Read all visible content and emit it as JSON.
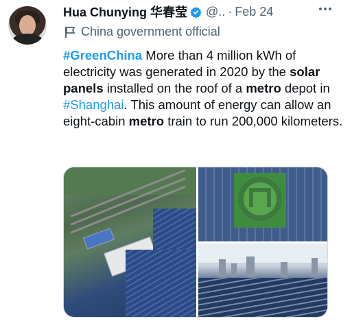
{
  "tweet": {
    "author_name": "Hua Chunying 华春莹",
    "handle": "@..",
    "separator": "·",
    "date": "Feb 24",
    "account_label": "China government official",
    "text": {
      "hashtag_green": "#GreenChina",
      "part1": " More than 4 million kWh of electricity was generated in 2020 by the ",
      "bold_solar": "solar panels",
      "part2": " installed on the roof of a ",
      "bold_metro1": "metro",
      "part3": " depot in ",
      "hashtag_shanghai": "#Shanghai",
      "part4": ". This amount of energy can allow an eight-cabin ",
      "bold_metro2": "metro",
      "part5": " train to run 200,000 kilometers."
    }
  },
  "icons": {
    "verified": "verified-badge-icon",
    "more": "more-options-icon",
    "government_label": "flag-icon"
  },
  "colors": {
    "link": "#1d9bf0",
    "secondary_text": "#536471",
    "verified_badge": "#1d9bf0"
  }
}
